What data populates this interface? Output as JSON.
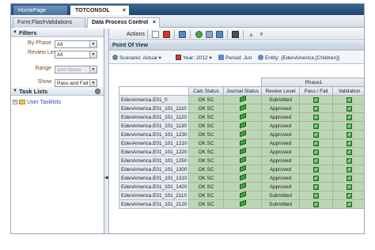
{
  "tabs": {
    "top": [
      {
        "label": "HomePage"
      },
      {
        "label": "TOTCONSOL",
        "close": "×"
      }
    ],
    "sub": [
      {
        "label": "Form:FlashValidations"
      },
      {
        "label": "Data Process Control",
        "close": "×"
      }
    ]
  },
  "left": {
    "filters_title": "Filters",
    "filters": [
      {
        "label": "By Phase",
        "value": "All",
        "disabled": false
      },
      {
        "label": "Review Levels",
        "value": "All",
        "disabled": false
      },
      {
        "label": "Range",
        "value": "and Above",
        "disabled": true
      },
      {
        "label": "Show",
        "value": "Pass and Fail",
        "disabled": false
      }
    ],
    "tasklists_title": "Task Lists",
    "tree_item": "User Tasklists",
    "expand_glyph": "+"
  },
  "toolbar": {
    "actions_label": "Actions"
  },
  "pov": {
    "title": "Point Of View",
    "scenario": "Scenario: Actual",
    "year": "Year: 2012",
    "period": "Period: Jun",
    "entity": "Entity: {EdenAmerica.[Children]}"
  },
  "grid": {
    "phase_header": "Phase1",
    "columns": [
      "Calc Status",
      "Journal Status",
      "Review Level",
      "Pass / Fail",
      "Validation"
    ],
    "rows": [
      {
        "entity": "EdenAmerica.E01_0",
        "calc": "OK SC",
        "review": "Submitted"
      },
      {
        "entity": "EdenAmerica.E01_101_1110",
        "calc": "OK SC",
        "review": "Approved"
      },
      {
        "entity": "EdenAmerica.E01_101_1120",
        "calc": "OK SC",
        "review": "Approved"
      },
      {
        "entity": "EdenAmerica.E01_101_1130",
        "calc": "OK SC",
        "review": "Approved"
      },
      {
        "entity": "EdenAmerica.E01_101_1230",
        "calc": "OK SC",
        "review": "Approved"
      },
      {
        "entity": "EdenAmerica.E01_101_1210",
        "calc": "OK SC",
        "review": "Approved"
      },
      {
        "entity": "EdenAmerica.E01_101_1220",
        "calc": "OK SC",
        "review": "Approved"
      },
      {
        "entity": "EdenAmerica.E01_101_1250",
        "calc": "OK SC",
        "review": "Approved"
      },
      {
        "entity": "EdenAmerica.E01_101_1300",
        "calc": "OK SC",
        "review": "Approved"
      },
      {
        "entity": "EdenAmerica.E01_101_1310",
        "calc": "OK SC",
        "review": "Approved"
      },
      {
        "entity": "EdenAmerica.E01_101_1420",
        "calc": "OK SC",
        "review": "Approved"
      },
      {
        "entity": "EdenAmerica.E01_101_2110",
        "calc": "OK SC",
        "review": "Submitted"
      },
      {
        "entity": "EdenAmerica.E01_101_2120",
        "calc": "OK SC",
        "review": "Submitted"
      }
    ]
  },
  "colors": {
    "topbar": "#1f4670",
    "cell_green": "#bcd7b4",
    "check_green": "#4ab04a",
    "link_blue": "#1f4aa8"
  }
}
